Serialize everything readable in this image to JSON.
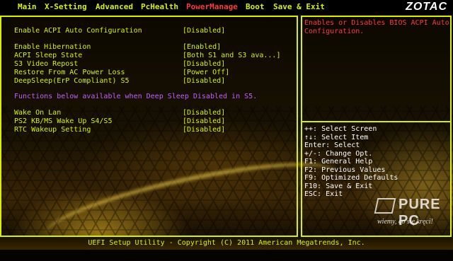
{
  "menu": {
    "items": [
      "Main",
      "X-Setting",
      "Advanced",
      "PcHealth",
      "PowerManage",
      "Boot",
      "Save & Exit"
    ],
    "active": "PowerManage",
    "logo": "ZOTAC"
  },
  "settings": [
    {
      "label": "Enable ACPI Auto Configuration",
      "value": "[Disabled]"
    },
    {
      "label": "Enable Hibernation",
      "value": "[Enabled]"
    },
    {
      "label": "ACPI Sleep State",
      "value": "[Both S1 and S3 ava...]"
    },
    {
      "label": "S3 Video Repost",
      "value": "[Disabled]"
    },
    {
      "label": "Restore From AC Power Loss",
      "value": "[Power Off]"
    },
    {
      "label": "DeepSleep(ErP Compliant) S5",
      "value": "[Disabled]"
    }
  ],
  "note": "Functions below available when Deep Sleep Disabled in S5.",
  "wake_settings": [
    {
      "label": "Wake On Lan",
      "value": "[Disabled]"
    },
    {
      "label": "PS2 KB/MS Wake Up S4/S5",
      "value": "[Disabled]"
    },
    {
      "label": "RTC Wakeup Setting",
      "value": "[Disabled]"
    }
  ],
  "help_text": "Enables or Disables BIOS ACPI Auto Configuration.",
  "key_help": [
    "++: Select Screen",
    "↑↓: Select Item",
    "Enter: Select",
    "+/-: Change Opt.",
    "F1: General Help",
    "F2: Previous Values",
    "F9: Optimized Defaults",
    "F10: Save & Exit",
    "ESC: Exit"
  ],
  "footer": "UEFI Setup Utility - Copyright (C) 2011 American Megatrends, Inc.",
  "watermark": {
    "brand": "PURE PC",
    "slogan": "wiemy, co się kręci!"
  },
  "colors": {
    "accent": "#d8f000",
    "active_menu": "#ff3a3a",
    "note": "#c060ff"
  }
}
